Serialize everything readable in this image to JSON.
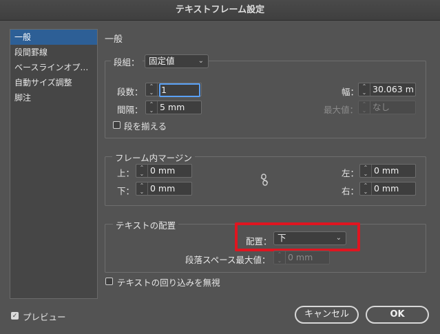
{
  "window": {
    "title": "テキストフレーム設定"
  },
  "sidebar": {
    "items": [
      {
        "label": "一般",
        "active": true
      },
      {
        "label": "段間罫線",
        "active": false
      },
      {
        "label": "ベースラインオプ…",
        "active": false
      },
      {
        "label": "自動サイズ調整",
        "active": false
      },
      {
        "label": "脚注",
        "active": false
      }
    ]
  },
  "main": {
    "section_title": "一般",
    "columns": {
      "label": "段組：",
      "type_value": "固定値",
      "count_label": "段数：",
      "count_value": "1",
      "width_label": "幅：",
      "width_value": "30.063 m",
      "gutter_label": "間隔：",
      "gutter_value": "5 mm",
      "max_label": "最大値：",
      "max_value": "なし",
      "balance_label": "段を揃える",
      "balance_checked": false
    },
    "inset": {
      "title": "フレーム内マージン",
      "top_label": "上：",
      "top_value": "0 mm",
      "bottom_label": "下：",
      "bottom_value": "0 mm",
      "left_label": "左：",
      "left_value": "0 mm",
      "right_label": "右：",
      "right_value": "0 mm",
      "link_icon": "link-broken-icon"
    },
    "vertical": {
      "title": "テキストの配置",
      "align_label": "配置：",
      "align_value": "下",
      "spacing_label": "段落スペース最大値：",
      "spacing_value": "0 mm"
    },
    "ignore_wrap_label": "テキストの回り込みを無視",
    "ignore_wrap_checked": false
  },
  "footer": {
    "preview_label": "プレビュー",
    "preview_checked": true,
    "cancel_label": "キャンセル",
    "ok_label": "OK"
  },
  "colors": {
    "accent": "#2d5f96",
    "focus": "#5aa0f5",
    "highlight": "#e01520",
    "background": "#535353"
  }
}
